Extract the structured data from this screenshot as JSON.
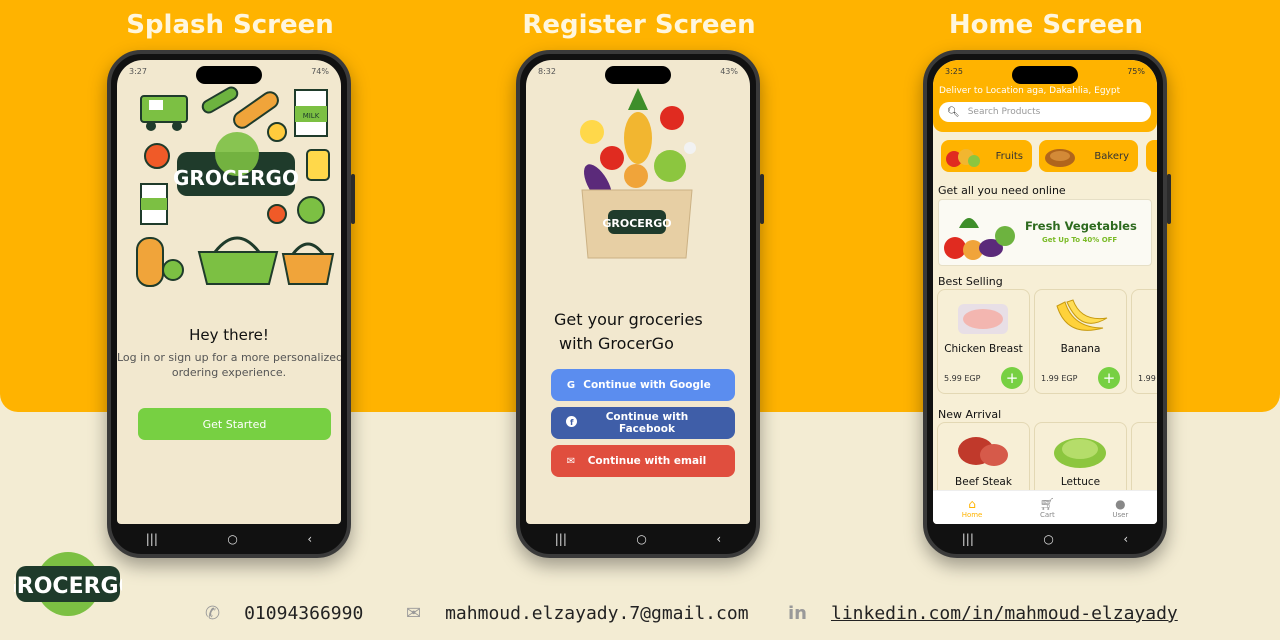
{
  "titles": {
    "splash": "Splash Screen",
    "register": "Register Screen",
    "home": "Home Screen"
  },
  "splash": {
    "status_time": "3:27",
    "status_battery": "74%",
    "logo_text": "GROCERGO",
    "greeting": "Hey there!",
    "subtext_line1": "Log in or sign up for a more personalized",
    "subtext_line2": "ordering experience.",
    "cta": "Get Started"
  },
  "register": {
    "status_time": "8:32",
    "status_battery": "43%",
    "bag_logo": "GROCERGO",
    "headline_line1": "Get your groceries",
    "headline_line2": "with GrocerGo",
    "buttons": [
      {
        "label": "Continue with Google",
        "icon": "google-icon",
        "color": "#5b8def"
      },
      {
        "label": "Continue with Facebook",
        "icon": "facebook-icon",
        "color": "#3f5ea8"
      },
      {
        "label": "Continue with email",
        "icon": "email-icon",
        "color": "#e04e3e"
      }
    ]
  },
  "home": {
    "status_time": "3:25",
    "status_battery": "75%",
    "location": "Deliver to Location aga, Dakahlia, Egypt",
    "search_placeholder": "Search Products",
    "categories": [
      "Fruits",
      "Bakery"
    ],
    "section_online": "Get all you need online",
    "banner_title": "Fresh Vegetables",
    "banner_sub": "Get Up To 40% OFF",
    "section_best": "Best Selling",
    "best": [
      {
        "name": "Chicken Breast",
        "price": "5.99 EGP"
      },
      {
        "name": "Banana",
        "price": "1.99 EGP"
      },
      {
        "name": "",
        "price": "1.99"
      }
    ],
    "section_new": "New Arrival",
    "new": [
      {
        "name": "Beef Steak"
      },
      {
        "name": "Lettuce"
      }
    ],
    "tabs": [
      "Home",
      "Cart",
      "User"
    ]
  },
  "footer": {
    "logo": "GROCERGO",
    "phone": "01094366990",
    "email": "mahmoud.elzayady.7@gmail.com",
    "linkedin": "linkedin.com/in/mahmoud-elzayady"
  },
  "colors": {
    "brand_yellow": "#ffb300",
    "cream": "#f3ecd3",
    "green": "#77d042"
  }
}
